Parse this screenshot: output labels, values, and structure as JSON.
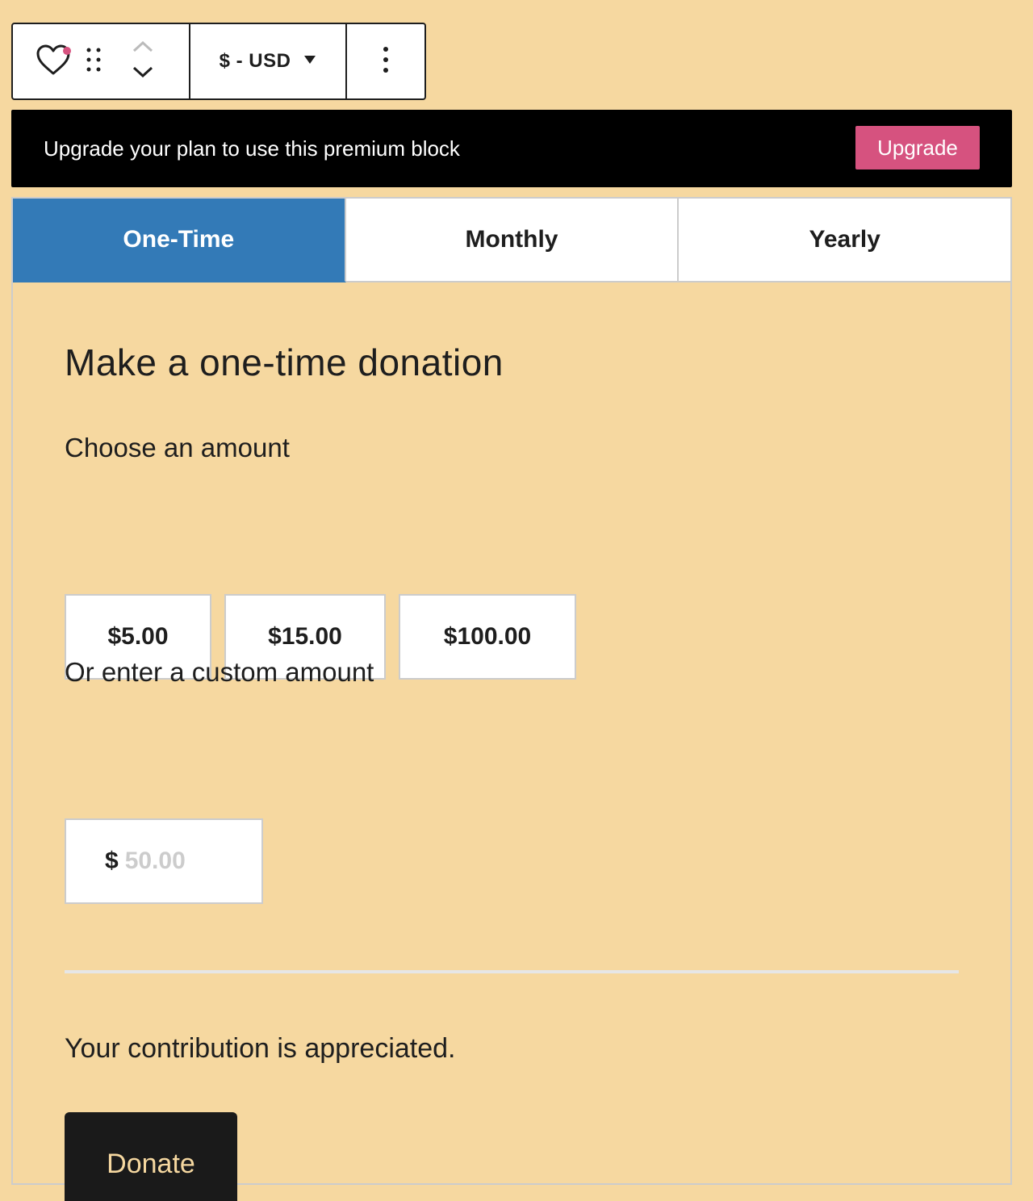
{
  "toolbar": {
    "block_icon": "heart-icon",
    "drag_icon": "drag-handle-icon",
    "move_up_icon": "chevron-up-icon",
    "move_down_icon": "chevron-down-icon",
    "currency": "$ - USD",
    "currency_dropdown_icon": "caret-down-icon",
    "more_icon": "more-vertical-icon"
  },
  "banner": {
    "text": "Upgrade your plan to use this premium block",
    "button_label": "Upgrade"
  },
  "tabs": [
    {
      "label": "One-Time",
      "active": true
    },
    {
      "label": "Monthly",
      "active": false
    },
    {
      "label": "Yearly",
      "active": false
    }
  ],
  "donation": {
    "heading": "Make a one-time donation",
    "choose_label": "Choose an amount",
    "amounts": [
      "$5.00",
      "$15.00",
      "$100.00"
    ],
    "custom_label": "Or enter a custom amount",
    "custom_currency": "$",
    "custom_placeholder": "50.00",
    "thanks_text": "Your contribution is appreciated.",
    "donate_label": "Donate"
  },
  "colors": {
    "background": "#f6d8a0",
    "tab_active": "#337ab7",
    "upgrade_button": "#d6527f",
    "donate_button": "#1a1a1a"
  }
}
